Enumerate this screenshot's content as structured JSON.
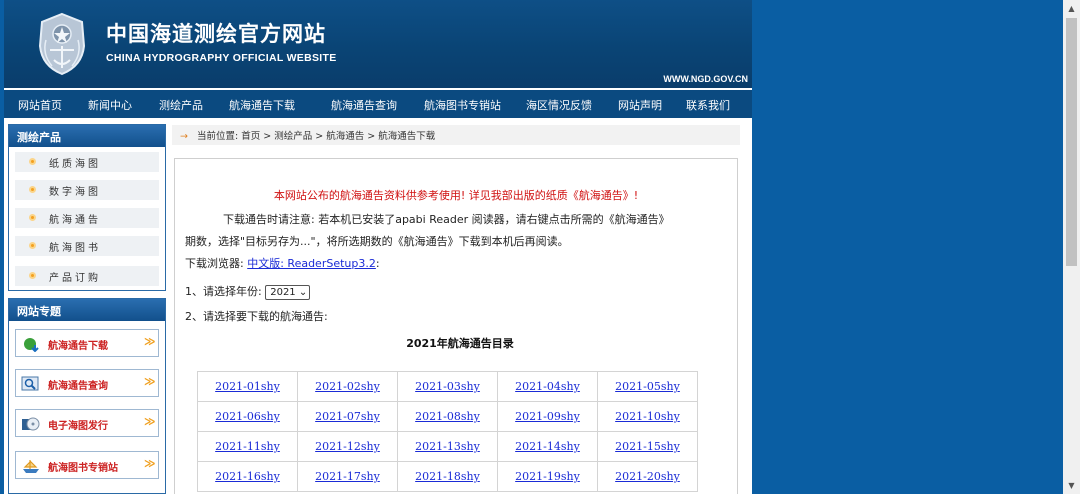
{
  "header": {
    "title": "中国海道测绘官方网站",
    "subtitle": "CHINA HYDROGRAPHY OFFICIAL WEBSITE",
    "url": "WWW.NGD.GOV.CN"
  },
  "nav": {
    "items": [
      "网站首页",
      "新闻中心",
      "测绘产品",
      "航海通告下载",
      "航海通告查询",
      "航海图书专销站",
      "海区情况反馈",
      "网站声明",
      "联系我们"
    ]
  },
  "sidebar": {
    "products": {
      "title": "测绘产品",
      "items": [
        "纸质海图",
        "数字海图",
        "航海通告",
        "航海图书",
        "产品订购"
      ]
    },
    "topics": {
      "title": "网站专题",
      "items": [
        "航海通告下载",
        "航海通告查询",
        "电子海图发行",
        "航海图书专销站"
      ],
      "arrow": "≫"
    }
  },
  "breadcrumb": {
    "arrow": "→",
    "text": "当前位置: 首页 > 测绘产品 > 航海通告 > 航海通告下载"
  },
  "content": {
    "notice": "本网站公布的航海通告资料供参考使用! 详见我部出版的纸质《航海通告》!",
    "instruction_line1": "下载通告时请注意: 若本机已安装了apabi Reader 阅读器，请右键点击所需的《航海通告》",
    "instruction_line2": "期数，选择\"目标另存为...\"，将所选期数的《航海通告》下载到本机后再阅读。",
    "browser_label": "下载浏览器:",
    "browser_link": "中文版: ReaderSetup3.2",
    "browser_suffix": ":",
    "step1_label": "1、请选择年份:",
    "year_selected": "2021",
    "year_caret": "⌄",
    "step2_label": "2、请选择要下载的航海通告:",
    "catalog_title": "2021年航海通告目录",
    "catalog": [
      [
        "2021-01shy",
        "2021-02shy",
        "2021-03shy",
        "2021-04shy",
        "2021-05shy"
      ],
      [
        "2021-06shy",
        "2021-07shy",
        "2021-08shy",
        "2021-09shy",
        "2021-10shy"
      ],
      [
        "2021-11shy",
        "2021-12shy",
        "2021-13shy",
        "2021-14shy",
        "2021-15shy"
      ],
      [
        "2021-16shy",
        "2021-17shy",
        "2021-18shy",
        "2021-19shy",
        "2021-20shy"
      ]
    ]
  },
  "scrollbar": {
    "up_glyph": "▲",
    "down_glyph": "▼"
  },
  "colors": {
    "header_bg": "#0a4475",
    "nav_bg": "#0b4a80",
    "page_bg": "#0a5ea3",
    "notice_red": "#d01010",
    "link_blue": "#1a2bd6"
  }
}
